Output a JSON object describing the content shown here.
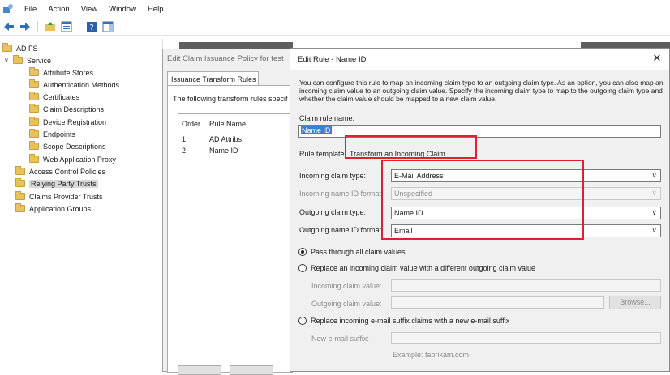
{
  "menubar": {
    "items": [
      "File",
      "Action",
      "View",
      "Window",
      "Help"
    ]
  },
  "toolbar": {
    "icons": [
      "back-arrow-icon",
      "forward-arrow-icon",
      "up-folder-icon",
      "show-hide-tree-icon",
      "help-icon",
      "show-hide-action-pane-icon"
    ]
  },
  "tree": {
    "root": "AD FS",
    "service": "Service",
    "service_children": [
      "Attribute Stores",
      "Authentication Methods",
      "Certificates",
      "Claim Descriptions",
      "Device Registration",
      "Endpoints",
      "Scope Descriptions",
      "Web Application Proxy"
    ],
    "access_control": "Access Control Policies",
    "relying_party": "Relying Party Trusts",
    "claims_provider": "Claims Provider Trusts",
    "application_groups": "Application Groups"
  },
  "policy_dialog": {
    "title": "Edit Claim Issuance Policy for test",
    "tab": "Issuance Transform Rules",
    "description": "The following transform rules specif",
    "columns": [
      "Order",
      "Rule Name"
    ],
    "rows": [
      {
        "order": "1",
        "name": "AD Attribs"
      },
      {
        "order": "2",
        "name": "Name ID"
      }
    ]
  },
  "edit_rule": {
    "title": "Edit Rule - Name ID",
    "close_glyph": "✕",
    "description": "You can configure this rule to map an incoming claim type to an outgoing claim type. As an option, you can also map an incoming claim value to an outgoing claim value. Specify the incoming claim type to map to the outgoing claim type and whether the claim value should be mapped to a new claim value.",
    "claim_rule_name_label": "Claim rule name:",
    "claim_rule_name_value": "Name ID",
    "rule_template_label": "Rule template:",
    "rule_template_value": "Transform an Incoming Claim",
    "incoming_claim_type_label": "Incoming claim type:",
    "incoming_claim_type_value": "E-Mail Address",
    "incoming_name_id_format_label": "Incoming name ID format:",
    "incoming_name_id_format_value": "Unspecified",
    "outgoing_claim_type_label": "Outgoing claim type:",
    "outgoing_claim_type_value": "Name ID",
    "outgoing_name_id_format_label": "Outgoing name ID format:",
    "outgoing_name_id_format_value": "Email",
    "radio_pass_through": "Pass through all claim values",
    "radio_replace_value": "Replace an incoming claim value with a different outgoing claim value",
    "incoming_claim_value_label": "Incoming claim value:",
    "outgoing_claim_value_label": "Outgoing claim value:",
    "browse_label": "Browse...",
    "radio_replace_suffix": "Replace incoming e-mail suffix claims with a new e-mail suffix",
    "new_email_suffix_label": "New e-mail suffix:",
    "example_text": "Example: fabrikam.com",
    "selected_option": "pass_through"
  },
  "colors": {
    "highlight_red": "#e0202d",
    "selection_blue": "#3b7fd4",
    "folder_yellow": "#e8c25a"
  }
}
